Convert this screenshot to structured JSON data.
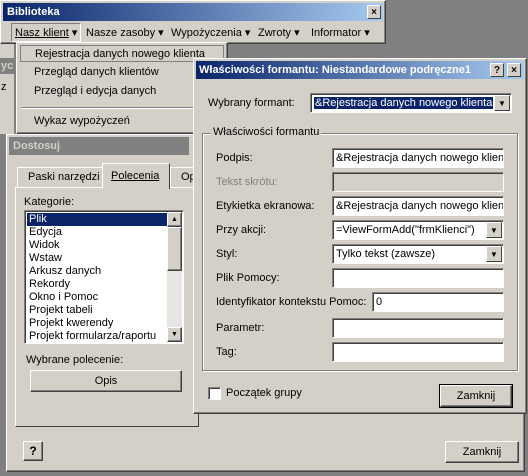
{
  "main_window": {
    "title": "Biblioteka",
    "close_glyph": "×",
    "menubar": [
      "Nasz klient",
      "Nasze zasoby",
      "Wypożyczenia",
      "Zwroty",
      "Informator"
    ],
    "menubar_arrow": "▾"
  },
  "dropdown_menu": {
    "items": [
      "Rejestracja danych nowego klienta",
      "Przegląd danych klientów",
      "Przegląd i edycja danych",
      "Wykaz wypożyczeń"
    ]
  },
  "background_fragments": {
    "left_top": "yc",
    "left_mid": "z"
  },
  "customize_dialog": {
    "title": "Dostosuj",
    "tabs": [
      "Paski narzędzi",
      "Polecenia",
      "Op"
    ],
    "categories_label": "Kategorie:",
    "categories": [
      "Plik",
      "Edycja",
      "Widok",
      "Wstaw",
      "Arkusz danych",
      "Rekordy",
      "Okno i Pomoc",
      "Projekt tabeli",
      "Projekt kwerendy",
      "Projekt formularza/raportu"
    ],
    "selected_command_label": "Wybrane polecenie:",
    "opis_button": "Opis",
    "help_glyph": "?",
    "close_button": "Zamknij"
  },
  "properties_dialog": {
    "title": "Właściwości formantu: Niestandardowe podręczne1",
    "help_glyph": "?",
    "close_glyph": "×",
    "selected_control_label": "Wybrany formant:",
    "selected_control_value": "&Rejestracja danych nowego klienta",
    "group_title": "Właściwości formantu",
    "fields": {
      "caption": {
        "label": "Podpis:",
        "value": "&Rejestracja danych nowego klient"
      },
      "shortcut": {
        "label": "Tekst skrótu:",
        "value": ""
      },
      "screentip": {
        "label": "Etykietka ekranowa:",
        "value": "&Rejestracja danych nowego klient"
      },
      "on_action": {
        "label": "Przy akcji:",
        "value": "=ViewFormAdd(\"frmKlienci\")"
      },
      "style": {
        "label": "Styl:",
        "value": "Tylko tekst (zawsze)"
      },
      "help_file": {
        "label": "Plik Pomocy:",
        "value": ""
      },
      "help_context": {
        "label": "Identyfikator kontekstu Pomoc:",
        "value": "0"
      },
      "parameter": {
        "label": "Parametr:",
        "value": ""
      },
      "tag": {
        "label": "Tag:",
        "value": ""
      }
    },
    "begin_group_label": "Początek grupy",
    "begin_group_checked": false,
    "close_button": "Zamknij",
    "dropdown_glyph": "▼"
  },
  "colors": {
    "title_active": "#0a246a",
    "title_inactive": "#808080",
    "face": "#d4d0c8",
    "highlight": "#0a246a"
  }
}
